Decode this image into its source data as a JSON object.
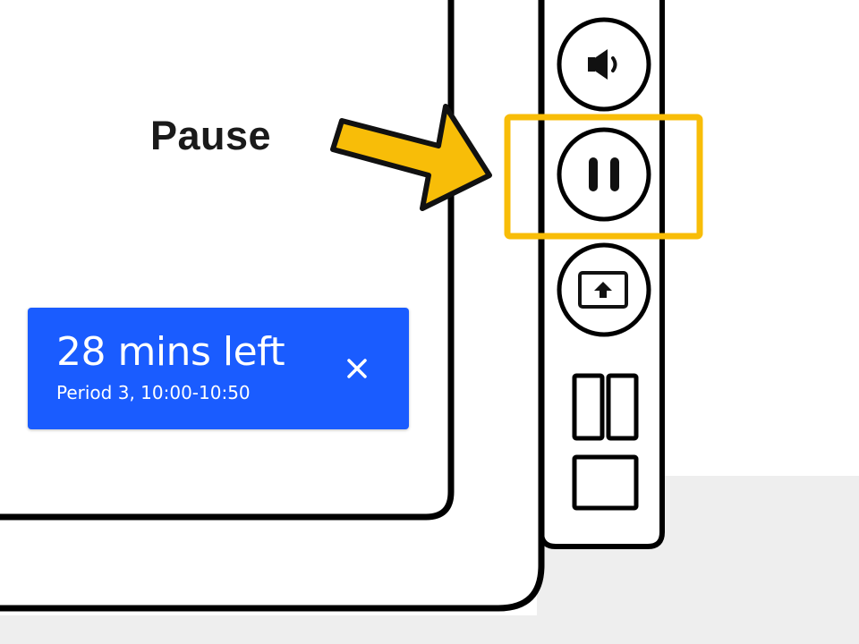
{
  "annotation": {
    "label": "Pause",
    "highlight_color": "#f8bd08",
    "arrow_color": "#f8bd08",
    "arrow_target": "pause-button"
  },
  "toolbar": {
    "buttons": [
      {
        "name": "volume-button",
        "icon": "speaker-icon"
      },
      {
        "name": "pause-button",
        "icon": "pause-icon"
      },
      {
        "name": "share-screen-button",
        "icon": "upload-screen-icon"
      },
      {
        "name": "layout-button",
        "icon": "layout-grid-icon"
      }
    ]
  },
  "toast": {
    "title": "28 mins left",
    "subtitle": "Period 3, 10:00-10:50",
    "close_icon": "close-icon",
    "background": "#1a5cff"
  },
  "colors": {
    "outline": "#000000",
    "page_background": "#ffffff",
    "desk_background": "#eeeeee"
  }
}
